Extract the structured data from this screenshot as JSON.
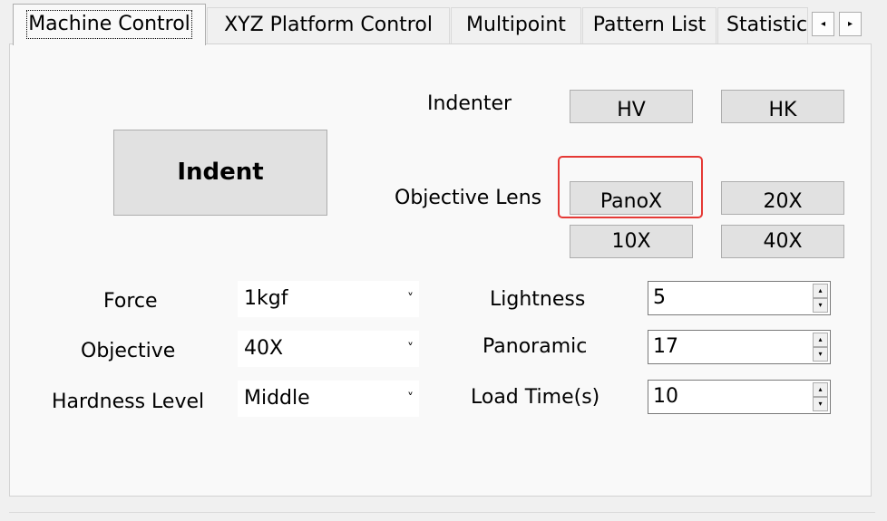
{
  "tabs": [
    {
      "label": "Machine Control",
      "active": true
    },
    {
      "label": "XYZ Platform Control",
      "active": false
    },
    {
      "label": "Multipoint",
      "active": false
    },
    {
      "label": "Pattern List",
      "active": false
    },
    {
      "label": "Statistic",
      "active": false
    }
  ],
  "tab_scroll": {
    "left_icon": "◂",
    "right_icon": "▸"
  },
  "indent_button": "Indent",
  "indenter": {
    "label": "Indenter",
    "options": [
      "HV",
      "HK"
    ]
  },
  "objective_lens": {
    "label": "Objective Lens",
    "options": [
      "PanoX",
      "20X",
      "10X",
      "40X"
    ],
    "highlighted": "PanoX"
  },
  "fields_left": [
    {
      "label": "Force",
      "value": "1kgf"
    },
    {
      "label": "Objective",
      "value": "40X"
    },
    {
      "label": "Hardness Level",
      "value": "Middle"
    }
  ],
  "fields_right": [
    {
      "label": "Lightness",
      "value": "5"
    },
    {
      "label": "Panoramic",
      "value": "17"
    },
    {
      "label": "Load Time(s)",
      "value": "10"
    }
  ],
  "icons": {
    "dropdown": "˅",
    "spin_up": "▴",
    "spin_down": "▾"
  },
  "colors": {
    "highlight": "#e53935"
  }
}
